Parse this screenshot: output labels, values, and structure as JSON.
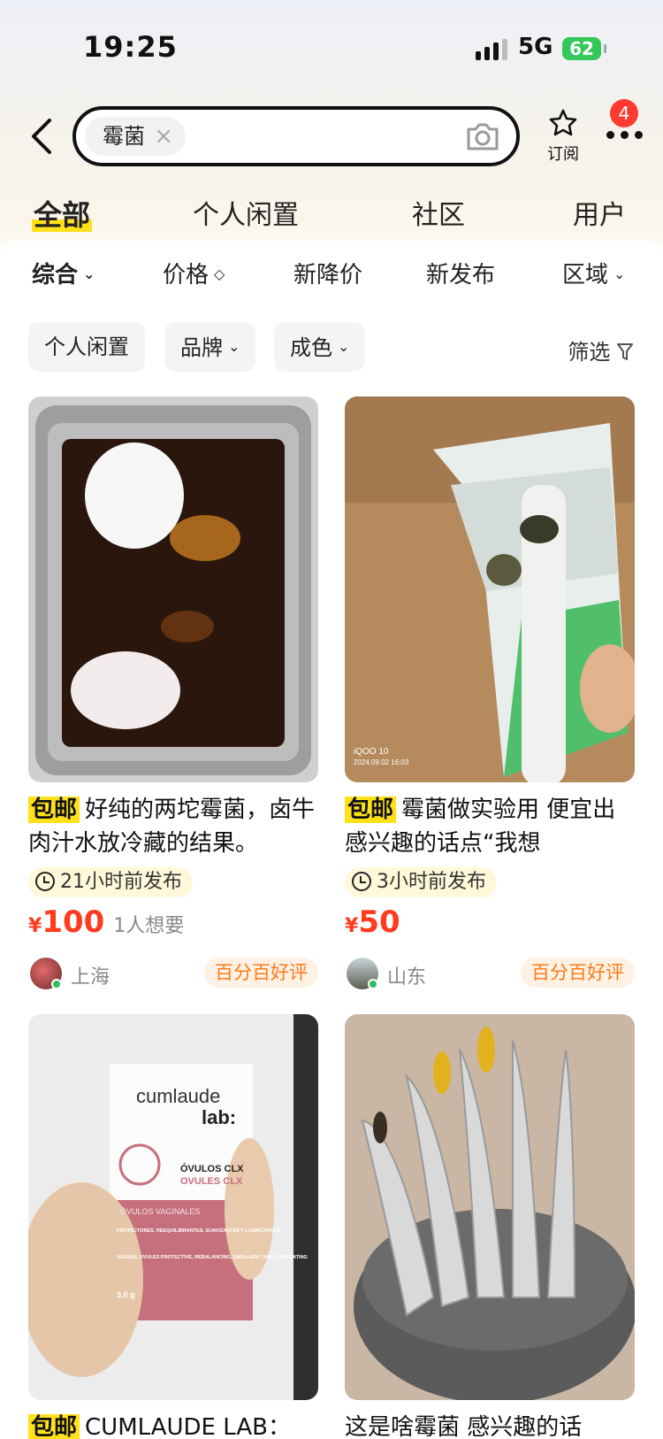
{
  "status_bar": {
    "time": "19:25",
    "network": "5G",
    "battery": "62"
  },
  "search": {
    "chip_label": "霉菌",
    "chip_close": "×"
  },
  "header": {
    "subscribe_label": "订阅",
    "notification_count": "4"
  },
  "tabs": [
    {
      "label": "全部",
      "active": true
    },
    {
      "label": "个人闲置"
    },
    {
      "label": "社区"
    },
    {
      "label": "用户"
    }
  ],
  "sort": [
    {
      "label": "综合",
      "arrow": "⌄"
    },
    {
      "label": "价格",
      "arrow": "◇"
    },
    {
      "label": "新降价"
    },
    {
      "label": "新发布"
    },
    {
      "label": "区域",
      "arrow": "⌄"
    }
  ],
  "filters": {
    "chips": [
      {
        "label": "个人闲置"
      },
      {
        "label": "品牌",
        "arrow": "⌄"
      },
      {
        "label": "成色",
        "arrow": "⌄"
      }
    ],
    "screen_label": "筛选"
  },
  "products": [
    {
      "tag": "包邮",
      "title": "好纯的两坨霉菌，卤牛肉汁水放冷藏的结果。",
      "time": "21小时前发布",
      "currency": "¥",
      "price": "100",
      "wants": "1人想要",
      "location": "上海",
      "rating": "百分百好评"
    },
    {
      "tag": "包邮",
      "title": "霉菌做实验用  便宜出 感兴趣的话点“我想",
      "time": "3小时前发布",
      "currency": "¥",
      "price": "50",
      "wants": "",
      "location": "山东",
      "rating": "百分百好评"
    },
    {
      "tag": "包邮",
      "title": "CUMLAUDE LAB：",
      "image_text": {
        "brand_line1": "cumlaude",
        "brand_line2": "lab:",
        "product1": "ÓVULOS CLX",
        "product2": "OVULES CLX",
        "band": "ÓVULOS VAGINALES",
        "desc1": "PROTECTORES, REEQUILIBRANTES, SUAVIZANTES Y LUBRICANTES",
        "desc2": "VAGINAL OVULES PROTECTIVE, REBALANCING, EMOLLIENT AND LUBRICATING",
        "weight": "3,0 g"
      }
    },
    {
      "tag": "",
      "title": "这是啥霉菌 感兴趣的话"
    }
  ],
  "image_overlays": {
    "camera_mark": "iQOO 10",
    "camera_date": "2024.09.02 16:03"
  }
}
